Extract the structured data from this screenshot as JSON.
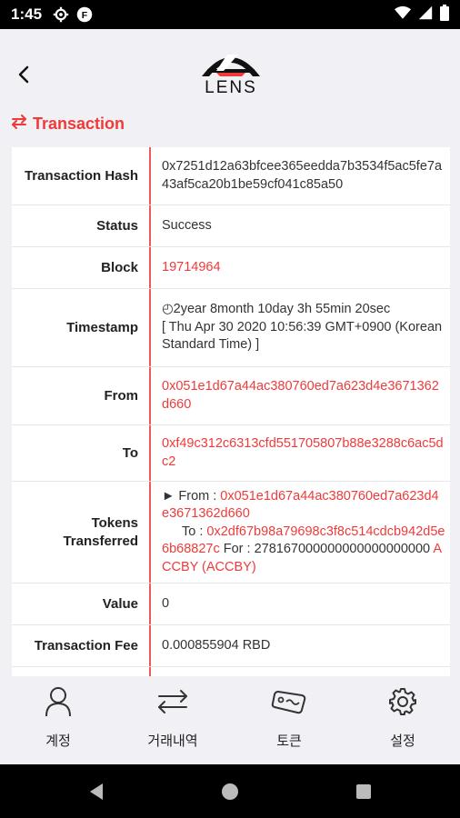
{
  "status_bar": {
    "time": "1:45",
    "icons_left": [
      "gear-icon",
      "app-badge-icon"
    ],
    "icons_right": [
      "wifi-icon",
      "cell-signal-icon",
      "battery-icon"
    ]
  },
  "header": {
    "logo_text": "LENS"
  },
  "section": {
    "title": "Transaction",
    "icon": "swap-arrows-icon"
  },
  "rows": {
    "hash": {
      "label": "Transaction Hash",
      "value": "0x7251d12a63bfcee365eedda7b3534f5ac5fe7a43af5ca20b1be59cf041c85a50"
    },
    "status": {
      "label": "Status",
      "value": "Success"
    },
    "block": {
      "label": "Block",
      "value": "19714964"
    },
    "timestamp": {
      "label": "Timestamp",
      "age": "◴2year 8month 10day 3h 55min 20sec",
      "date": "[ Thu Apr 30 2020 10:56:39 GMT+0900 (Korean Standard Time) ]"
    },
    "from": {
      "label": "From",
      "value": "0x051e1d67a44ac380760ed7a623d4e3671362d660"
    },
    "to": {
      "label": "To",
      "value": "0xf49c312c6313cfd551705807b88e3288c6ac5dc2"
    },
    "tokens": {
      "label": "Tokens Transferred",
      "from_prefix": "► From : ",
      "from_addr": "0x051e1d67a44ac380760ed7a623d4e3671362d660",
      "to_prefix": "To : ",
      "to_addr": "0x2df67b98a79698c3f8c514cdcb942d5e6b68827c",
      "for_text": " For : 278167000000000000000000 ",
      "token_name": "ACCBY (ACCBY)"
    },
    "value": {
      "label": "Value",
      "value": "0"
    },
    "fee": {
      "label": "Transaction Fee",
      "value": "0.000855904 RBD"
    }
  },
  "bottom_nav": {
    "account": "계정",
    "history": "거래내역",
    "token": "토큰",
    "settings": "설정"
  },
  "colors": {
    "accent": "#f03a3a",
    "background": "#f1f1f5"
  }
}
